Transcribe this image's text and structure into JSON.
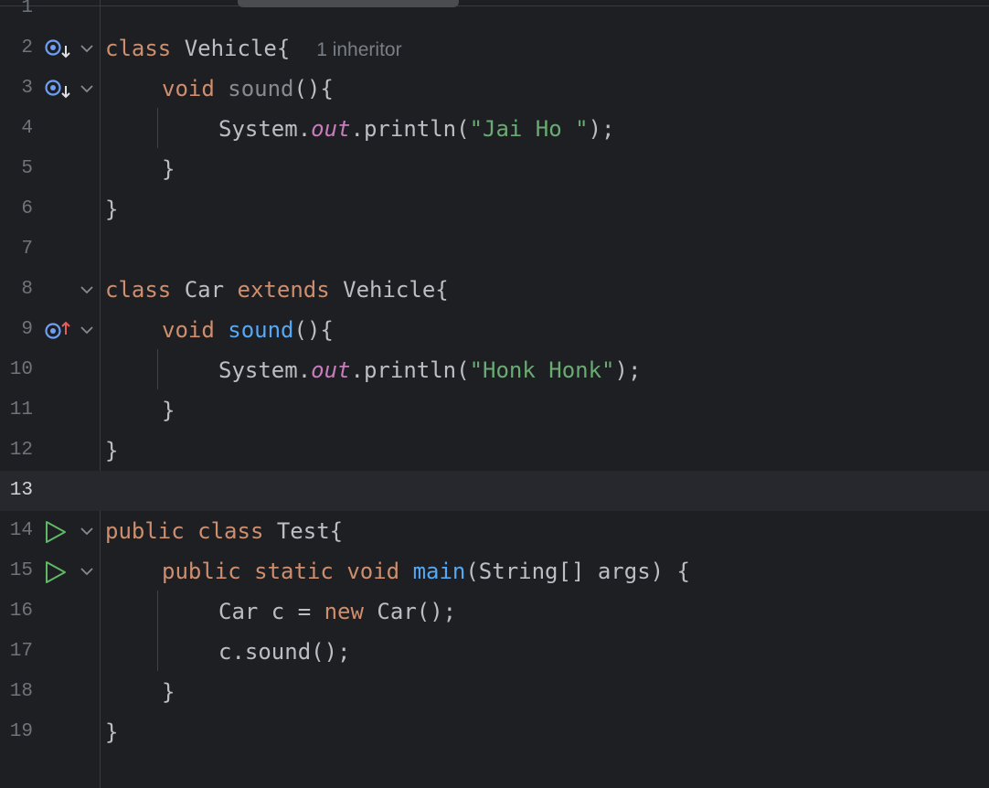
{
  "editor": {
    "language": "java",
    "current_line": "13",
    "lines": [
      {
        "number": "1"
      },
      {
        "number": "2",
        "tokens": [
          "class",
          "Vehicle{"
        ],
        "hint": "1 inheritor"
      },
      {
        "number": "3",
        "tokens": [
          "void",
          "sound",
          "(){"
        ]
      },
      {
        "number": "4",
        "tokens": [
          "System.",
          "out",
          ".println(",
          "\"Jai Ho \"",
          ");"
        ]
      },
      {
        "number": "5",
        "tokens": [
          "}"
        ]
      },
      {
        "number": "6",
        "tokens": [
          "}"
        ]
      },
      {
        "number": "7"
      },
      {
        "number": "8",
        "tokens": [
          "class",
          "Car",
          "extends",
          "Vehicle{"
        ]
      },
      {
        "number": "9",
        "tokens": [
          "void",
          "sound",
          "(){"
        ]
      },
      {
        "number": "10",
        "tokens": [
          "System.",
          "out",
          ".println(",
          "\"Honk Honk\"",
          ");"
        ]
      },
      {
        "number": "11",
        "tokens": [
          "}"
        ]
      },
      {
        "number": "12",
        "tokens": [
          "}"
        ]
      },
      {
        "number": "13"
      },
      {
        "number": "14",
        "tokens": [
          "public",
          "class",
          "Test{"
        ]
      },
      {
        "number": "15",
        "tokens": [
          "public",
          "static",
          "void",
          "main",
          "(String[] args) {"
        ]
      },
      {
        "number": "16",
        "tokens": [
          "Car c =",
          "new",
          "Car();"
        ]
      },
      {
        "number": "17",
        "tokens": [
          "c.sound();"
        ]
      },
      {
        "number": "18",
        "tokens": [
          "}"
        ]
      },
      {
        "number": "19",
        "tokens": [
          "}"
        ]
      }
    ]
  },
  "gutter_icons": {
    "2": "implemented-down-icon",
    "3": "implemented-down-icon",
    "9": "overrides-up-icon",
    "14": "run-icon",
    "15": "run-icon"
  },
  "colors": {
    "background": "#1e1f22",
    "keyword": "#cf8e6d",
    "function": "#56a8f5",
    "string": "#6aab73",
    "static_field": "#c77dbb",
    "text": "#bcbec4",
    "run_icon": "#5fb865",
    "override_arrow": "#e55c5c",
    "implemented_icon": "#6e9ff5"
  }
}
